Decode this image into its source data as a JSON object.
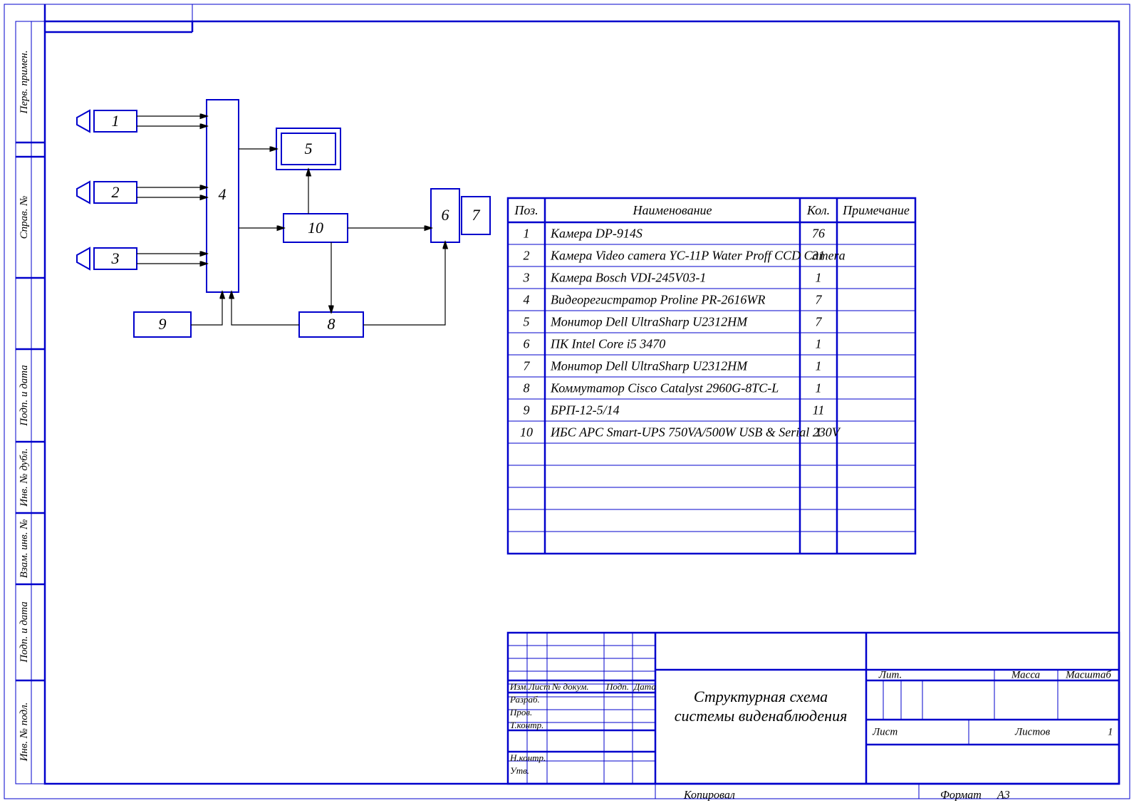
{
  "sidebar": {
    "c1": "Перв. примен.",
    "c2": "Справ. №",
    "c3": "Подп. и дата",
    "c4": "Инв. № дубл.",
    "c5": "Взам. инв. №",
    "c6": "Подп. и дата",
    "c7": "Инв. № подл."
  },
  "diagram": {
    "b1": "1",
    "b2": "2",
    "b3": "3",
    "b4": "4",
    "b5": "5",
    "b6": "6",
    "b7": "7",
    "b8": "8",
    "b9": "9",
    "b10": "10"
  },
  "table": {
    "h_pos": "Поз.",
    "h_name": "Наименование",
    "h_qty": "Кол.",
    "h_note": "Примечание",
    "rows": [
      {
        "pos": "1",
        "name": "Камера DP-914S",
        "qty": "76",
        "note": ""
      },
      {
        "pos": "2",
        "name": "Камера Video camera YC-11P Water Proff CCD Camera",
        "qty": "31",
        "note": ""
      },
      {
        "pos": "3",
        "name": "Камера Bosch VDI-245V03-1",
        "qty": "1",
        "note": ""
      },
      {
        "pos": "4",
        "name": "Видеорегистратор Proline PR-2616WR",
        "qty": "7",
        "note": ""
      },
      {
        "pos": "5",
        "name": "Монитор Dell UltraSharp U2312HM",
        "qty": "7",
        "note": ""
      },
      {
        "pos": "6",
        "name": "ПК Intel Core i5 3470",
        "qty": "1",
        "note": ""
      },
      {
        "pos": "7",
        "name": "Монитор Dell UltraSharp U2312HM",
        "qty": "1",
        "note": ""
      },
      {
        "pos": "8",
        "name": "Коммутатор Cisco Catalyst 2960G-8TC-L",
        "qty": "1",
        "note": ""
      },
      {
        "pos": "9",
        "name": "БРП-12-5/14",
        "qty": "11",
        "note": ""
      },
      {
        "pos": "10",
        "name": "ИБС APC Smart-UPS 750VA/500W USB & Serial 230V",
        "qty": "1",
        "note": ""
      }
    ]
  },
  "titleblock": {
    "izm": "Изм.",
    "list": "Лист",
    "ndok": "№ докум.",
    "podp": "Подп.",
    "data": "Дата",
    "razrab": "Разраб.",
    "prov": "Пров.",
    "tkontr": "Т.контр.",
    "nkontr": "Н.контр.",
    "utv": "Утв.",
    "title_l1": "Структурная схема",
    "title_l2": "системы виденаблюдения",
    "lit": "Лит.",
    "massa": "Масса",
    "mash": "Масштаб",
    "list2": "Лист",
    "listov": "Листов",
    "listov_n": "1",
    "kopiroval": "Копировал",
    "format": "Формат",
    "format_v": "А3"
  }
}
